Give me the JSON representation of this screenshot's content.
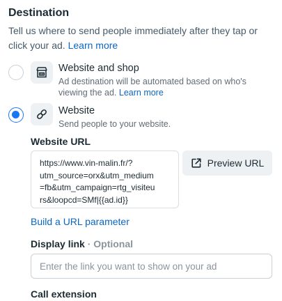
{
  "destination": {
    "title": "Destination",
    "description": "Tell us where to send people immediately after they tap or click your ad.",
    "learn_more": "Learn more"
  },
  "options": [
    {
      "label": "Website and shop",
      "sub": "Ad destination will be automated based on who's viewing the ad.",
      "learn_more": "Learn more",
      "selected": false,
      "icon": "storefront-icon"
    },
    {
      "label": "Website",
      "sub": "Send people to your website.",
      "selected": true,
      "icon": "link-icon"
    }
  ],
  "website_url": {
    "label": "Website URL",
    "value": "https://www.vin-malin.fr/?\nutm_source=orx&utm_medium\n=fb&utm_campaign=rtg_visiteu\nrs&loopcd=SMf|{{ad.id}}",
    "preview_label": "Preview URL",
    "preview_icon": "external-link-icon",
    "build_param_link": "Build a URL parameter"
  },
  "display_link": {
    "label": "Display link",
    "optional": "· Optional",
    "placeholder": "Enter the link you want to show on your ad"
  },
  "call_extension": {
    "label": "Call extension"
  },
  "colors": {
    "accent": "#1877f2",
    "link": "#0a66c2",
    "text": "#1c2b33"
  }
}
